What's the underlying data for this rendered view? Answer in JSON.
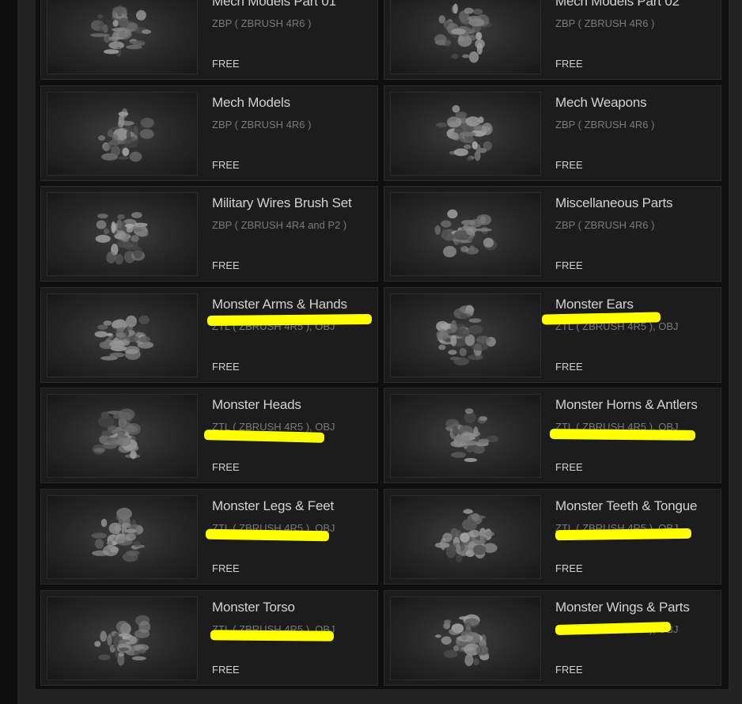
{
  "colors": {
    "highlight": "#ffff00",
    "card_bg": "#1c1c1c",
    "title_text": "#d2d2d2",
    "format_text": "#7a7a7a"
  },
  "items": [
    {
      "title": "Mech Models Part 01",
      "format": "ZBP ( ZBRUSH 4R6 )",
      "price": "FREE",
      "thumb_icon": "mech-sculpt-thumbnail",
      "highlighted": false
    },
    {
      "title": "Mech Models Part 02",
      "format": "ZBP ( ZBRUSH 4R6 )",
      "price": "FREE",
      "thumb_icon": "mech-sculpt-thumbnail",
      "highlighted": false
    },
    {
      "title": "Mech Models",
      "format": "ZBP ( ZBRUSH 4R6 )",
      "price": "FREE",
      "thumb_icon": "mech-sculpt-thumbnail",
      "highlighted": false
    },
    {
      "title": "Mech Weapons",
      "format": "ZBP ( ZBRUSH 4R6 )",
      "price": "FREE",
      "thumb_icon": "weapons-sculpt-thumbnail",
      "highlighted": false
    },
    {
      "title": "Military Wires Brush Set",
      "format": "ZBP ( ZBRUSH 4R4 and P2 )",
      "price": "FREE",
      "thumb_icon": "wires-sphere-thumbnail",
      "highlighted": false
    },
    {
      "title": "Miscellaneous Parts",
      "format": "ZBP ( ZBRUSH 4R6 )",
      "price": "FREE",
      "thumb_icon": "parts-sculpt-thumbnail",
      "highlighted": false
    },
    {
      "title": "Monster Arms & Hands",
      "format": "ZTL ( ZBRUSH 4R5 ), OBJ",
      "price": "FREE",
      "thumb_icon": "monster-arms-thumbnail",
      "highlighted": true
    },
    {
      "title": "Monster Ears",
      "format": "ZTL ( ZBRUSH 4R5 ), OBJ",
      "price": "FREE",
      "thumb_icon": "monster-ears-thumbnail",
      "highlighted": true
    },
    {
      "title": "Monster Heads",
      "format": "ZTL ( ZBRUSH 4R5 ), OBJ",
      "price": "FREE",
      "thumb_icon": "monster-heads-thumbnail",
      "highlighted": true
    },
    {
      "title": "Monster Horns & Antlers",
      "format": "ZTL ( ZBRUSH 4R5 ), OBJ",
      "price": "FREE",
      "thumb_icon": "monster-horns-thumbnail",
      "highlighted": true
    },
    {
      "title": "Monster Legs & Feet",
      "format": "ZTL ( ZBRUSH 4R5 ), OBJ",
      "price": "FREE",
      "thumb_icon": "monster-legs-thumbnail",
      "highlighted": true
    },
    {
      "title": "Monster Teeth & Tongue",
      "format": "ZTL ( ZBRUSH 4R5 ), OBJ",
      "price": "FREE",
      "thumb_icon": "monster-teeth-thumbnail",
      "highlighted": true
    },
    {
      "title": "Monster Torso",
      "format": "ZTL ( ZBRUSH 4R5 ), OBJ",
      "price": "FREE",
      "thumb_icon": "monster-torso-thumbnail",
      "highlighted": true
    },
    {
      "title": "Monster Wings & Parts",
      "format": "ZTL ( ZBRUSH 4R5 ), OBJ",
      "price": "FREE",
      "thumb_icon": "monster-wings-thumbnail",
      "highlighted": true
    }
  ]
}
